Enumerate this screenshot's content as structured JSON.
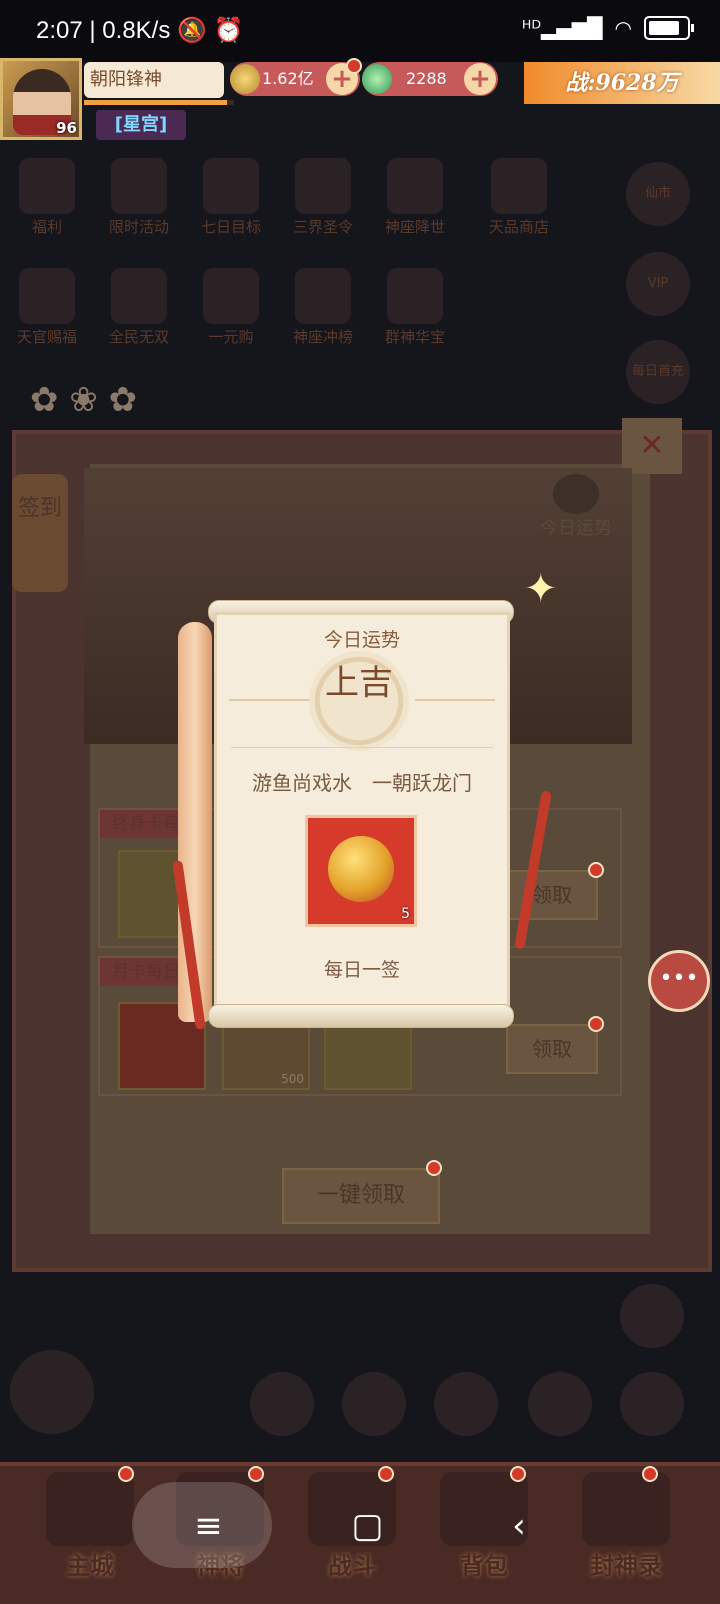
{
  "status_bar": {
    "time": "2:07",
    "network_speed": "0.8K/s",
    "icons": [
      "mute-icon",
      "alarm-icon",
      "hd-signal-icon",
      "wifi-icon",
      "battery-icon"
    ]
  },
  "player": {
    "name": "朝阳锋神",
    "level": "96",
    "title": "[星宫]",
    "exp_progress": 0.95
  },
  "resources": {
    "coins": "1.62亿",
    "jade": "2288",
    "power": "战:9628万"
  },
  "background_menu": {
    "row1": [
      "福利",
      "限时活动",
      "七日目标",
      "三界圣令",
      "神座降世",
      "天品商店"
    ],
    "row2": [
      "天官赐福",
      "全民无双",
      "一元购",
      "神座冲榜",
      "群神华宝"
    ],
    "right": [
      "仙市",
      "VIP",
      "每日首充"
    ]
  },
  "signin": {
    "side_tab": "签到",
    "today_fortune_button": "今日运势",
    "lifetime_card_header": "终身卡每",
    "monthly_card_header": "月卡每日",
    "claim_label": "领取",
    "one_click_claim": "一键领取",
    "item_qty_500": "500"
  },
  "fortune_popup": {
    "title": "今日运势",
    "result": "上吉",
    "verse": "游鱼尚戏水　一朝跃龙门",
    "reward_qty": "5",
    "footer": "每日一签"
  },
  "bottom_nav": [
    "主城",
    "神将",
    "战斗",
    "背包",
    "封神录"
  ],
  "colors": {
    "accent_red": "#d63a2a",
    "scroll_paper": "#f5ecdc",
    "panel_brown": "#4b3330"
  }
}
